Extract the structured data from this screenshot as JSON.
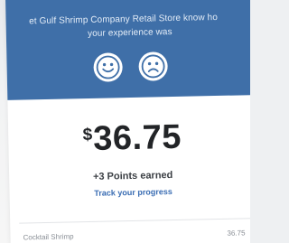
{
  "feedback": {
    "prompt_line1": "et Gulf Shrimp Company Retail Store know ho",
    "prompt_line2": "your experience was",
    "happy_icon": "happy-face-icon",
    "sad_icon": "sad-face-icon"
  },
  "total": {
    "currency": "$",
    "amount": "36.75"
  },
  "rewards": {
    "points_earned": "+3 Points earned",
    "track_link": "Track your progress"
  },
  "line_items": [
    {
      "name": "Cocktail Shrimp",
      "price": "36.75"
    }
  ],
  "colors": {
    "panel": "#3f6fa8",
    "link": "#3a6db3",
    "amount_text": "#222427"
  }
}
